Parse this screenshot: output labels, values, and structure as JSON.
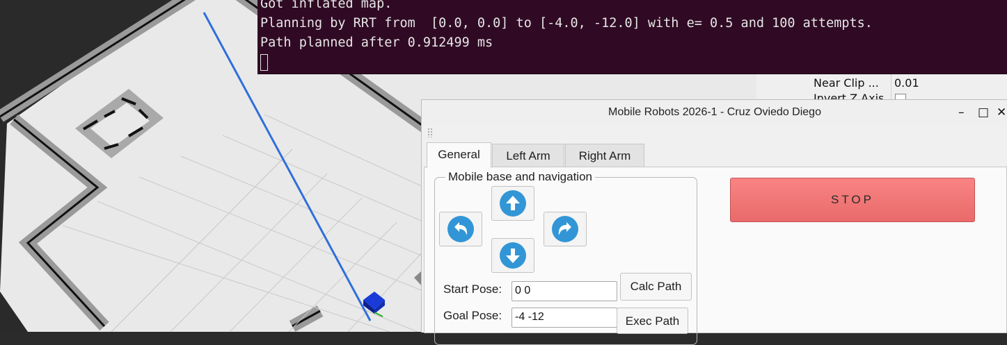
{
  "terminal": {
    "lines": [
      "Got inflated map.",
      "Planning by RRT from  [0.0, 0.0] to [-4.0, -12.0] with e= 0.5 and 100 attempts.",
      "Path planned after 0.912499 ms"
    ]
  },
  "rviz_props": {
    "near_clip_label": "Near Clip ...",
    "near_clip_value": "0.01",
    "invert_z_label": "Invert Z Axis"
  },
  "window": {
    "title": "Mobile Robots 2026-1 - Cruz Oviedo Diego",
    "minimize": "–",
    "maximize": "□",
    "close": "✕"
  },
  "tabs": [
    {
      "label": "General",
      "active": true
    },
    {
      "label": "Left Arm",
      "active": false
    },
    {
      "label": "Right Arm",
      "active": false
    }
  ],
  "navigation": {
    "group_title": "Mobile base and navigation",
    "buttons": [
      "arrow-up-icon",
      "arrow-down-icon",
      "turn-left-icon",
      "turn-right-icon"
    ],
    "start_pose_label": "Start Pose:",
    "start_pose_value": "0 0",
    "goal_pose_label": "Goal Pose:",
    "goal_pose_value": "-4 -12",
    "calc_path_label": "Calc Path",
    "exec_path_label": "Exec Path"
  },
  "stop": {
    "label": "STOP",
    "color": "#f07878"
  },
  "colors": {
    "terminal_bg": "#300a24",
    "nav_icon": "#3296d6",
    "path_line": "#2f6fdc",
    "robot": "#1a3bd8"
  }
}
